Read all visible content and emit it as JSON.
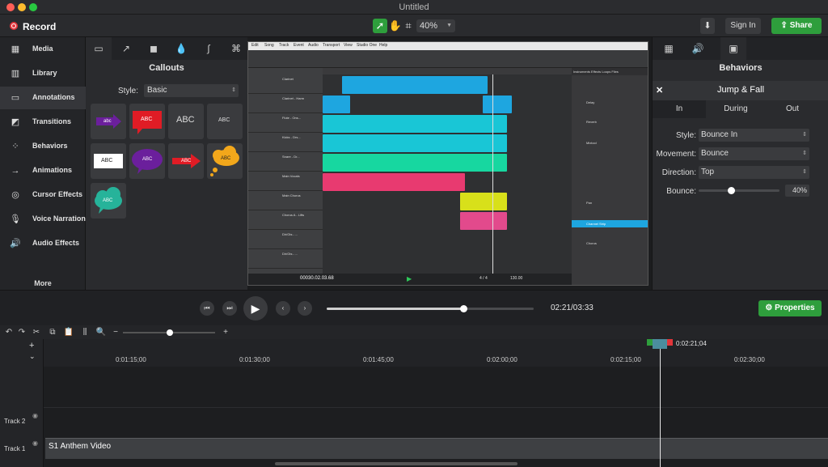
{
  "window": {
    "title": "Untitled"
  },
  "toolbar": {
    "record_label": "Record",
    "zoom_value": "40%",
    "sign_in_label": "Sign In",
    "share_label": "Share",
    "tools": [
      "pointer-icon",
      "hand-icon",
      "crop-icon"
    ]
  },
  "sidebar": {
    "items": [
      {
        "label": "Media",
        "icon": "media-icon"
      },
      {
        "label": "Library",
        "icon": "library-icon"
      },
      {
        "label": "Annotations",
        "icon": "annotations-icon"
      },
      {
        "label": "Transitions",
        "icon": "transitions-icon"
      },
      {
        "label": "Behaviors",
        "icon": "behaviors-icon"
      },
      {
        "label": "Animations",
        "icon": "animations-icon"
      },
      {
        "label": "Cursor Effects",
        "icon": "cursor-effects-icon"
      },
      {
        "label": "Voice Narration",
        "icon": "microphone-icon"
      },
      {
        "label": "Audio Effects",
        "icon": "speaker-icon"
      }
    ],
    "active_index": 2,
    "more_label": "More"
  },
  "callouts": {
    "title": "Callouts",
    "style_label": "Style:",
    "style_value": "Basic",
    "tile_text": "ABC",
    "tile_text_lower": "abc"
  },
  "daw": {
    "menu": [
      "Edit",
      "Song",
      "Track",
      "Event",
      "Audio",
      "Transport",
      "View",
      "Studio One",
      "Help"
    ],
    "tracks": [
      "Clarinet",
      "Clarinet - Harm",
      "Flute - Ons...",
      "Kicks - Drs...",
      "Snare - Dr...",
      "Main Vocals",
      "Main Chorus",
      "Chorus A - Lifts",
      "Dir/Gts - ...",
      "Dir/Gts - ..."
    ],
    "transport_time": "00030.02.03.68",
    "tempo": "130.00",
    "signature": "4 / 4",
    "browser_tabs": [
      "Instruments",
      "Effects",
      "Loops",
      "Files"
    ],
    "browser_items": [
      "Delay",
      "Reverb",
      "Mixtool",
      "Pan",
      "Channel Strip",
      "Chorus"
    ],
    "selected_item": "Channel Strip"
  },
  "props": {
    "title": "Behaviors",
    "behavior_name": "Jump & Fall",
    "tabs": [
      "In",
      "During",
      "Out"
    ],
    "active_tab": 0,
    "fields": [
      {
        "label": "Style:",
        "value": "Bounce In"
      },
      {
        "label": "Movement:",
        "value": "Bounce"
      },
      {
        "label": "Direction:",
        "value": "Top"
      }
    ],
    "bounce_label": "Bounce:",
    "bounce_value": "40%",
    "bounce_fraction": 0.4
  },
  "playback": {
    "current_time": "02:21",
    "total_time": "03:33",
    "time_readout": "02:21/03:33",
    "progress_fraction": 0.66,
    "properties_label": "Properties"
  },
  "timeline": {
    "ticks": [
      "0:01:15;00",
      "0:01:30;00",
      "0:01:45;00",
      "0:02:00;00",
      "0:02:15;00",
      "0:02:30;00"
    ],
    "playhead_time": "0:02:21;04",
    "tracks": [
      {
        "label": "Track 2"
      },
      {
        "label": "Track 1"
      }
    ],
    "clip_name": "S1 Anthem Video"
  },
  "colors": {
    "accent_green": "#2e9e3c",
    "record_red": "#e3353a",
    "clip_blue": "#1ea6e0",
    "clip_cyan": "#19c6d6",
    "clip_teal": "#17d7a0",
    "clip_pink": "#e83a70",
    "clip_yellow": "#d8e01a",
    "clip_magenta": "#e24a8c"
  }
}
